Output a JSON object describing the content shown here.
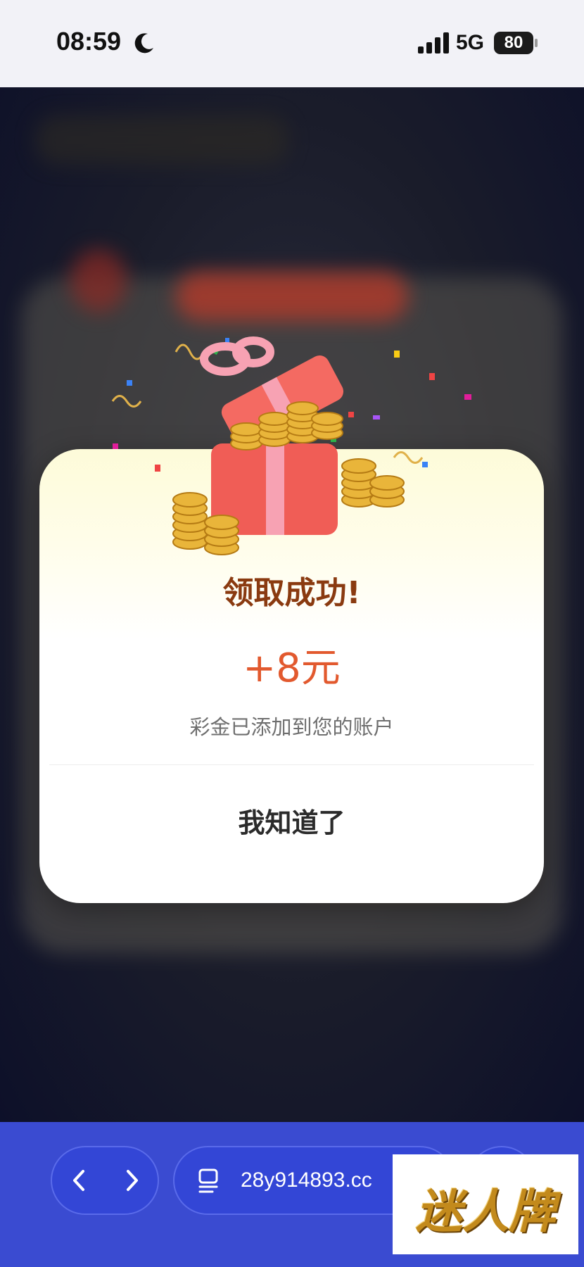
{
  "status_bar": {
    "time": "08:59",
    "network": "5G",
    "battery": "80"
  },
  "modal": {
    "title": "领取成功!",
    "amount": "+8元",
    "message": "彩金已添加到您的账户",
    "button_label": "我知道了"
  },
  "toolbar": {
    "url": "28y914893.cc"
  },
  "watermark": {
    "text": "迷人牌"
  },
  "colors": {
    "title": "#8a3a10",
    "amount": "#e2592e",
    "toolbar": "#3a4bd1"
  }
}
